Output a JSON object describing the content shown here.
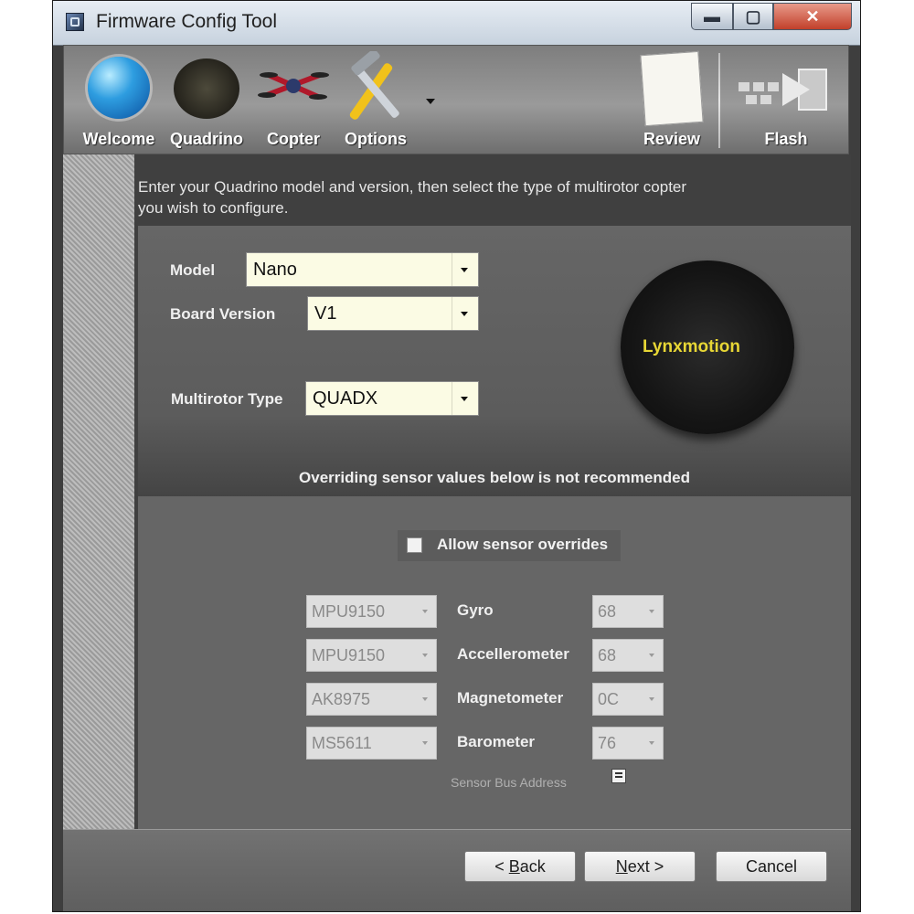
{
  "window": {
    "title": "Firmware Config Tool",
    "controls": {
      "minimize": "▬",
      "maximize": "▢",
      "close": "✕"
    }
  },
  "toolbar": {
    "items": [
      {
        "label": "Welcome",
        "icon": "globe-icon"
      },
      {
        "label": "Quadrino",
        "icon": "circuit-board-icon"
      },
      {
        "label": "Copter",
        "icon": "quadcopter-icon"
      },
      {
        "label": "Options",
        "icon": "tools-icon"
      },
      {
        "label": "Review",
        "icon": "notepad-pencil-icon"
      },
      {
        "label": "Flash",
        "icon": "chip-arrow-icon"
      }
    ]
  },
  "instructions": {
    "line1": "Enter your Quadrino model and version, then select the type of multirotor copter",
    "line2": "you wish to configure."
  },
  "config": {
    "model": {
      "label": "Model",
      "value": "Nano"
    },
    "board_version": {
      "label": "Board Version",
      "value": "V1"
    },
    "multirotor_type": {
      "label": "Multirotor Type",
      "value": "QUADX"
    }
  },
  "board_image": {
    "logo_text": "Lynxmotion"
  },
  "warning": "Overriding sensor values below is not recommended",
  "overrides": {
    "allow_label": "Allow sensor overrides",
    "checked": false
  },
  "sensors": [
    {
      "chip": "MPU9150",
      "label": "Gyro",
      "address": "68"
    },
    {
      "chip": "MPU9150",
      "label": "Accellerometer",
      "address": "68"
    },
    {
      "chip": "AK8975",
      "label": "Magnetometer",
      "address": "0C"
    },
    {
      "chip": "MS5611",
      "label": "Barometer",
      "address": "76"
    }
  ],
  "bus_address_label": "Sensor Bus Address",
  "footer": {
    "back": {
      "prefix": "< ",
      "accel": "B",
      "rest": "ack"
    },
    "next": {
      "accel": "N",
      "rest": "ext >"
    },
    "cancel": "Cancel"
  },
  "colors": {
    "input_bg": "#fbfbe4",
    "window_bg": "#3e3e3e",
    "close_red": "#c2402a"
  }
}
